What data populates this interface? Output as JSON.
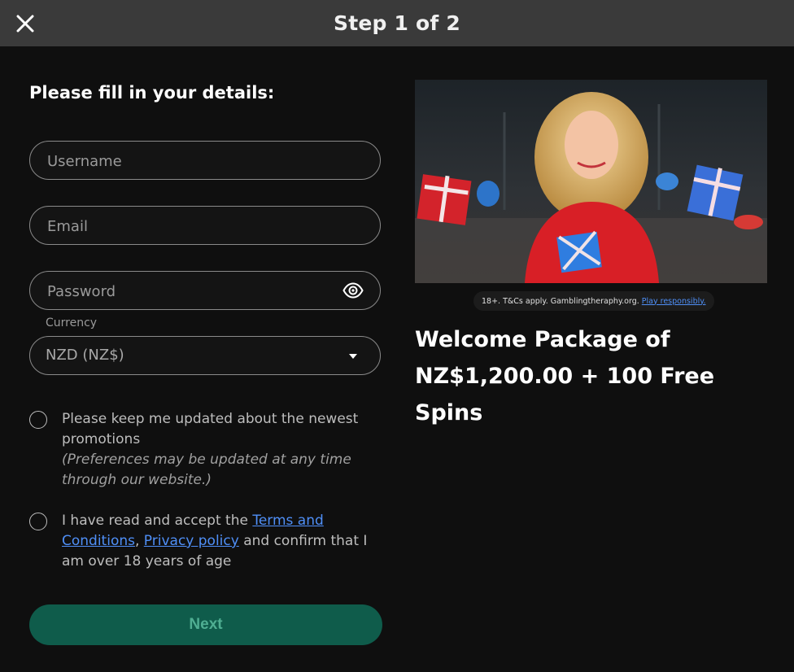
{
  "header": {
    "title": "Step 1 of 2",
    "close_icon": "close-icon"
  },
  "form": {
    "heading": "Please fill in your details:",
    "username_placeholder": "Username",
    "email_placeholder": "Email",
    "password_placeholder": "Password",
    "password_toggle_icon": "eye-icon",
    "currency_label": "Currency",
    "currency_value": "NZD (NZ$)",
    "promotions_text": "Please keep me updated about the newest promotions",
    "promotions_note": "(Preferences may be updated at any time through our website.)",
    "terms_prefix": "I have read and accept the ",
    "terms_link": "Terms and Conditions",
    "terms_separator": ", ",
    "privacy_link": "Privacy policy",
    "terms_suffix": " and confirm that I am over 18 years of age",
    "next_label": "Next"
  },
  "promo": {
    "disclaimer": "18+. T&Cs apply. Gamblingtheraphy.org.",
    "disclaimer_link": "Play responsibly.",
    "welcome_line1": "Welcome Package of",
    "welcome_line2": "NZ$1,200.00 + 100 Free Spins"
  },
  "colors": {
    "header_bg": "#3a3a3a",
    "page_bg": "#0f0f0f",
    "link": "#4f8ff7",
    "button_bg": "#0f5c4b",
    "button_text": "#4fae92"
  }
}
